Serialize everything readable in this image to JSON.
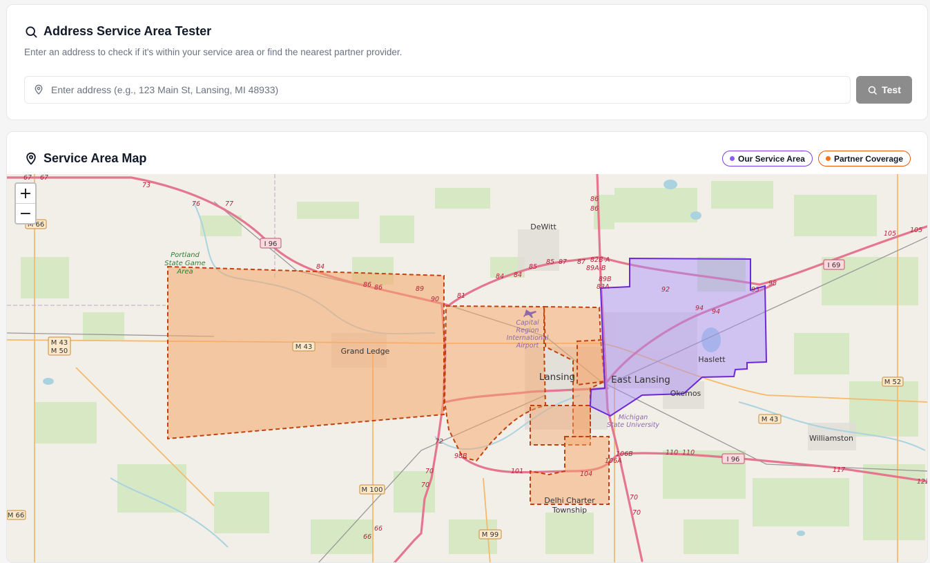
{
  "tester": {
    "title": "Address Service Area Tester",
    "subtitle": "Enter an address to check if it's within your service area or find the nearest partner provider.",
    "input_placeholder": "Enter address (e.g., 123 Main St, Lansing, MI 48933)",
    "input_value": "",
    "test_label": "Test"
  },
  "map_card": {
    "title": "Service Area Map",
    "legend": {
      "ours_label": "Our Service Area",
      "ours_color": "#8b5cf6",
      "partner_label": "Partner Coverage",
      "partner_color": "#f97316"
    }
  },
  "map": {
    "zoom_in": "+",
    "zoom_out": "−",
    "places": {
      "dewitt": "DeWitt",
      "portland": "Portland",
      "state_game": "State Game",
      "area": "Area",
      "grand_ledge": "Grand Ledge",
      "capital": "Capital",
      "region": "Region",
      "international": "International",
      "airport": "Airport",
      "lansing": "Lansing",
      "east_lansing": "East Lansing",
      "haslett": "Haslett",
      "okemos": "Okemos",
      "michigan": "Michigan",
      "msu": "State University",
      "williamston": "Williamston",
      "delhi": "Delhi Charter",
      "township": "Township"
    },
    "shields": {
      "i96_west": "I 96",
      "i96_east": "I 96",
      "i69": "I 69",
      "m66_a": "M 66",
      "m66_b": "M 66",
      "m43_a": "M 43",
      "m50": "M 50",
      "m43_b": "M 43",
      "m43_c": "M 43",
      "m52": "M 52",
      "m100": "M 100",
      "m99": "M 99"
    },
    "exits": {
      "e67a": "67",
      "e67b": "67",
      "e73": "73",
      "e76": "76",
      "e77": "77",
      "e84": "84",
      "e86a": "86",
      "e86b": "86",
      "e89": "89",
      "e90": "90",
      "e81": "81",
      "e84b": "84",
      "e84c": "84",
      "e85a": "85",
      "e85b": "85",
      "e87a": "87",
      "e87b": "87",
      "e86c": "86",
      "e86d": "86",
      "e82ba": "82B-A",
      "e89ab": "89A-B",
      "e89b": "89B",
      "e83a": "83A",
      "e92": "92",
      "e94a": "94",
      "e94b": "94",
      "e93": "93",
      "e98": "98",
      "e105a": "105",
      "e105b": "105",
      "e110a": "110",
      "e110b": "110",
      "e117": "117",
      "e122": "122",
      "e106b": "106B",
      "e106a": "106A",
      "e104": "104",
      "e101": "101",
      "e70a": "70",
      "e70b": "70",
      "e70c": "70",
      "e70d": "70",
      "e72": "72",
      "e98b": "98B",
      "e66a": "66",
      "e66b": "66"
    }
  }
}
